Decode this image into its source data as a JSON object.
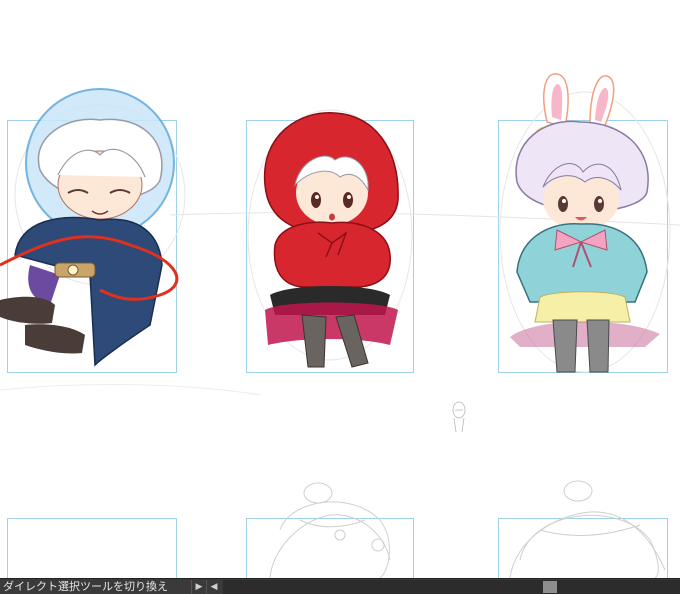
{
  "statusbar": {
    "hint_text": "ダイレクト選択ツールを切り換え",
    "left_arrow_icon": "triangle-right-icon",
    "scroll_left_icon": "triangle-left-icon"
  },
  "canvas": {
    "frame_color": "#9fd2e8",
    "characters": [
      {
        "name": "astronaut-character",
        "colors": [
          "#2d4a78",
          "#e0301e",
          "#8fc6ef"
        ]
      },
      {
        "name": "red-hood-character",
        "colors": [
          "#d8262e",
          "#2a2a2a",
          "#c0154b"
        ]
      },
      {
        "name": "bunny-character",
        "colors": [
          "#8fd3d8",
          "#f4a3c0",
          "#f6efa8"
        ]
      }
    ]
  }
}
